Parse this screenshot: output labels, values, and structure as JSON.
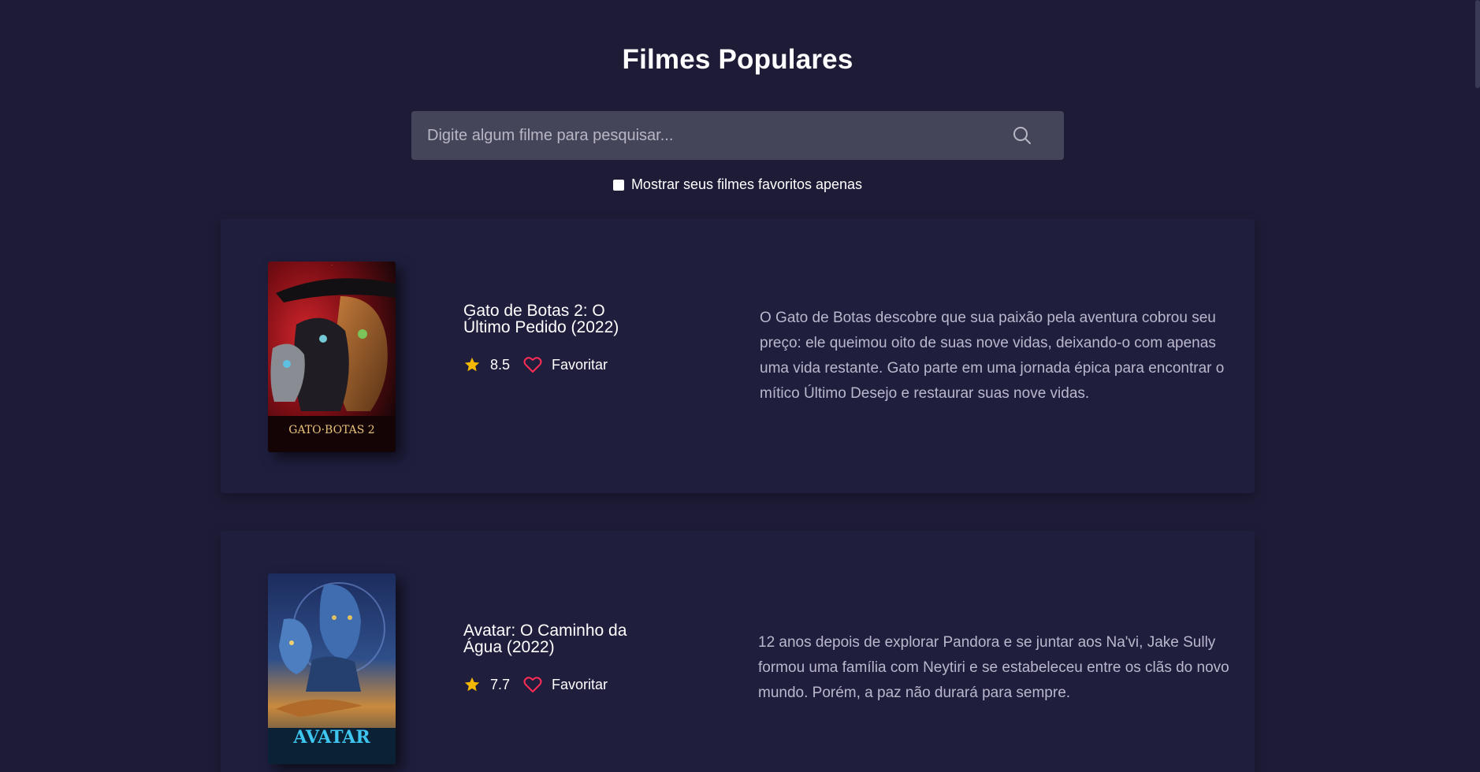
{
  "header": {
    "title": "Filmes Populares"
  },
  "search": {
    "placeholder": "Digite algum filme para pesquisar...",
    "value": "",
    "icon": "search-icon"
  },
  "filter": {
    "label": "Mostrar seus filmes favoritos apenas",
    "checked": false
  },
  "colors": {
    "background": "#1d1b36",
    "card": "#1f1e3d",
    "search_bg": "#45455a",
    "star": "#f5b800",
    "heart": "#ff2d55"
  },
  "movies": [
    {
      "title": "Gato de Botas 2: O Último Pedido (2022)",
      "rating": "8.5",
      "favorite_label": "Favoritar",
      "description": "O Gato de Botas descobre que sua paixão pela aventura cobrou seu preço: ele queimou oito de suas nove vidas, deixando-o com apenas uma vida restante. Gato parte em uma jornada épica para encontrar o mítico Último Desejo e restaurar suas nove vidas.",
      "poster_text": "GATO DE BOTAS 2"
    },
    {
      "title": "Avatar: O Caminho da Água (2022)",
      "rating": "7.7",
      "favorite_label": "Favoritar",
      "description": "12 anos depois de explorar Pandora e se juntar aos Na'vi, Jake Sully formou uma família com Neytiri e se estabeleceu entre os clãs do novo mundo. Porém, a paz não durará para sempre.",
      "poster_text": "AVATAR"
    }
  ]
}
